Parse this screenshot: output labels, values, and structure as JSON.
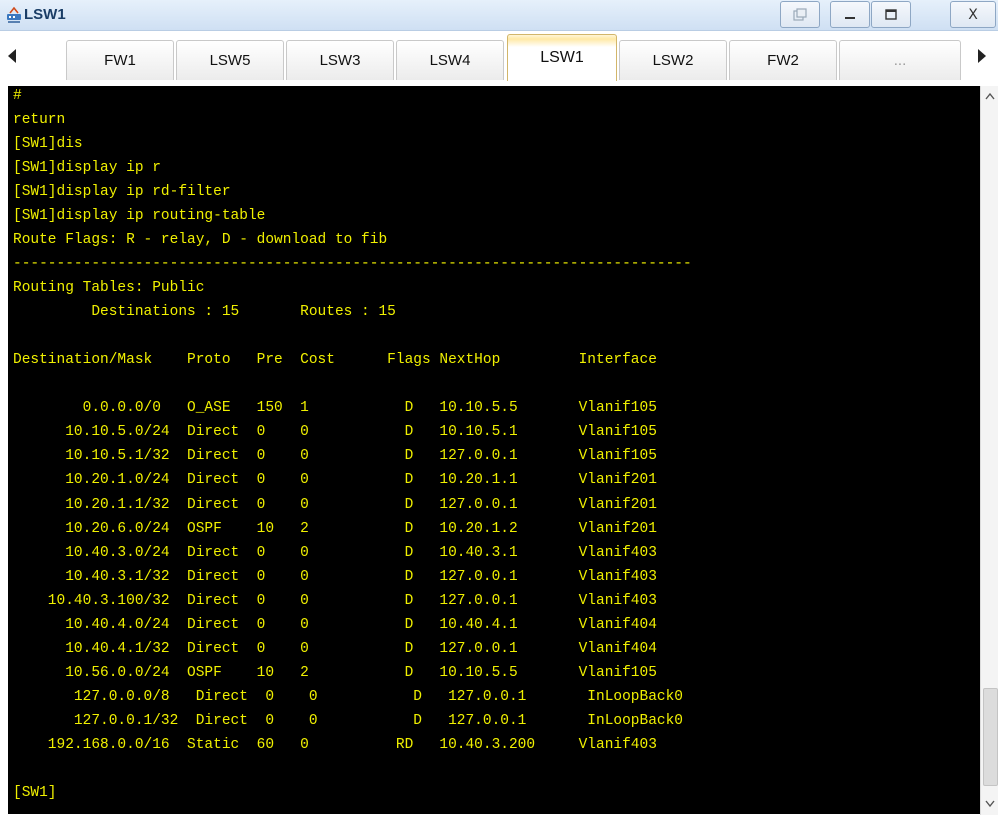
{
  "window": {
    "title": "LSW1",
    "icon": "device-network-icon",
    "controls": {
      "restore": "restore-icon",
      "minimize": "minimize-icon",
      "maximize": "maximize-icon",
      "close": "X"
    }
  },
  "tabs": [
    {
      "label": "FW1"
    },
    {
      "label": "LSW5"
    },
    {
      "label": "LSW3"
    },
    {
      "label": "LSW4"
    },
    {
      "label": "LSW1"
    },
    {
      "label": "LSW2"
    },
    {
      "label": "FW2"
    },
    {
      "label": "..."
    }
  ],
  "active_tab": "LSW1",
  "terminal": {
    "text_color": "#f0f000",
    "background": "#000000",
    "lines": [
      "#",
      "return",
      "[SW1]dis",
      "[SW1]display ip r",
      "[SW1]display ip rd-filter",
      "[SW1]display ip routing-table",
      "Route Flags: R - relay, D - download to fib",
      "------------------------------------------------------------------------------",
      "Routing Tables: Public",
      "         Destinations : 15       Routes : 15",
      "",
      "Destination/Mask    Proto   Pre  Cost      Flags NextHop         Interface",
      "",
      "        0.0.0.0/0   O_ASE   150  1           D   10.10.5.5       Vlanif105",
      "      10.10.5.0/24  Direct  0    0           D   10.10.5.1       Vlanif105",
      "      10.10.5.1/32  Direct  0    0           D   127.0.0.1       Vlanif105",
      "      10.20.1.0/24  Direct  0    0           D   10.20.1.1       Vlanif201",
      "      10.20.1.1/32  Direct  0    0           D   127.0.0.1       Vlanif201",
      "      10.20.6.0/24  OSPF    10   2           D   10.20.1.2       Vlanif201",
      "      10.40.3.0/24  Direct  0    0           D   10.40.3.1       Vlanif403",
      "      10.40.3.1/32  Direct  0    0           D   127.0.0.1       Vlanif403",
      "    10.40.3.100/32  Direct  0    0           D   127.0.0.1       Vlanif403",
      "      10.40.4.0/24  Direct  0    0           D   10.40.4.1       Vlanif404",
      "      10.40.4.1/32  Direct  0    0           D   127.0.0.1       Vlanif404",
      "      10.56.0.0/24  OSPF    10   2           D   10.10.5.5       Vlanif105",
      "       127.0.0.0/8   Direct  0    0           D   127.0.0.1       InLoopBack0",
      "       127.0.0.1/32  Direct  0    0           D   127.0.0.1       InLoopBack0",
      "    192.168.0.0/16  Static  60   0          RD   10.40.3.200     Vlanif403",
      "",
      "[SW1]"
    ]
  }
}
